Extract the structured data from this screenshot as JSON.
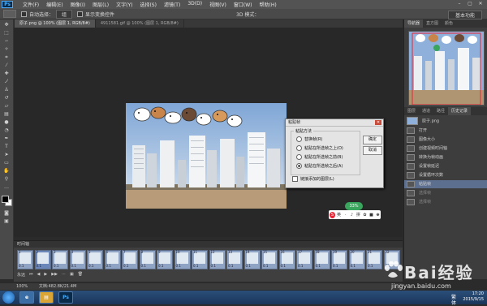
{
  "app": {
    "logo": "Ps"
  },
  "menubar": {
    "items": [
      "文件(F)",
      "编辑(E)",
      "图像(I)",
      "图层(L)",
      "文字(Y)",
      "选择(S)",
      "滤镜(T)",
      "3D(D)",
      "视图(V)",
      "窗口(W)",
      "帮助(H)"
    ]
  },
  "options": {
    "auto_select": "自动选择：",
    "group": "组",
    "show_transform": "显示变换控件",
    "mode3d": "3D 模式：",
    "workspace": "基本功能"
  },
  "tabs": [
    {
      "label": "原子.png @ 100% (图层 1, RGB/8#)"
    },
    {
      "label": "4911581.gif @ 100% (图层 1, RGB/8#)"
    }
  ],
  "dialog": {
    "title": "粘贴帧",
    "group_label": "粘贴方法",
    "options": [
      "替换帧(R)",
      "粘贴在所选帧之上(O)",
      "粘贴在所选帧之前(B)",
      "粘贴在所选帧之后(A)"
    ],
    "selected_index": 3,
    "ok": "确定",
    "cancel": "取消",
    "link_label": "链接添加的图层(L)"
  },
  "right_panel": {
    "nav_tabs": [
      "导航器",
      "直方图",
      "颜色"
    ],
    "history_tabs": [
      "图层",
      "通道",
      "路径",
      "历史记录"
    ],
    "history_doc": "原子.png",
    "history": [
      {
        "label": "打开",
        "state": "normal"
      },
      {
        "label": "图像大小",
        "state": "normal"
      },
      {
        "label": "创建视频时间轴",
        "state": "normal"
      },
      {
        "label": "转换为帧动画",
        "state": "normal"
      },
      {
        "label": "设置帧延迟",
        "state": "normal"
      },
      {
        "label": "设置循环次数",
        "state": "normal"
      },
      {
        "label": "粘贴帧",
        "state": "active"
      },
      {
        "label": "选择帧",
        "state": "dim"
      },
      {
        "label": "选择帧",
        "state": "dim"
      }
    ]
  },
  "timeline": {
    "title": "时间轴",
    "frames": [
      "1",
      "2",
      "3",
      "4",
      "5",
      "6",
      "7",
      "8",
      "9",
      "10",
      "11",
      "12",
      "13",
      "14",
      "15",
      "16",
      "17",
      "18",
      "19",
      "20",
      "21",
      "22"
    ],
    "frame_delay": "0.1",
    "loop": "永远"
  },
  "ime": {
    "badge": "33%",
    "chars": [
      "S",
      "英",
      "·",
      "♪",
      "拼",
      "✿",
      "■",
      "♚"
    ]
  },
  "status": {
    "zoom": "100%",
    "doc_info": "文档:482.8K/21.4M"
  },
  "taskbar": {
    "tray_ime": "繁体",
    "time": "17:20",
    "date": "2015/9/15"
  },
  "watermark": {
    "text": "Bai经验",
    "url": "jingyan.baidu.com"
  },
  "colors": {
    "bg": "#2b2b2b",
    "panel": "#3d3d3d",
    "history_active": "#5d6f8f",
    "frame": "#8fa3c4"
  }
}
